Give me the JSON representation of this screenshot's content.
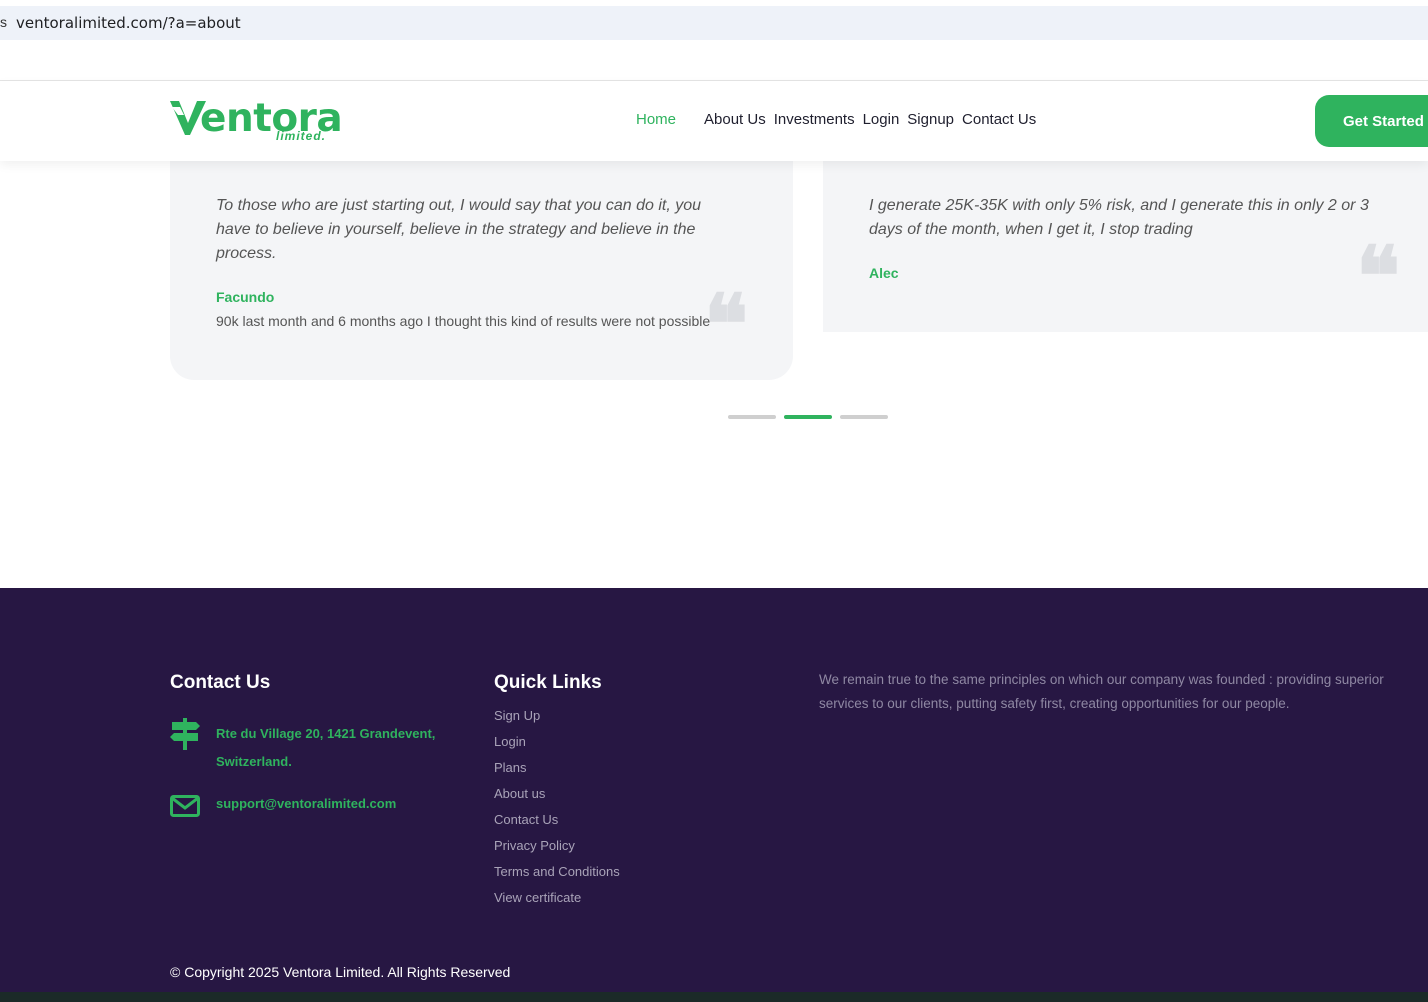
{
  "browser": {
    "lead_glyph": "s",
    "url": "ventoralimited.com/?a=about"
  },
  "header": {
    "logo_text": "entora",
    "logo_sub": "limited.",
    "nav": [
      {
        "label": "Home",
        "active": true
      },
      {
        "label": "About Us"
      },
      {
        "label": "Investments"
      },
      {
        "label": "Login"
      },
      {
        "label": "Signup"
      },
      {
        "label": "Contact Us"
      }
    ],
    "cta_label": "Get Started"
  },
  "testimonials": [
    {
      "quote": "To those who are just starting out, I would say that you can do it, you have to believe in yourself, believe in the strategy and believe in the process.",
      "author": "Facundo",
      "note": "90k last month and 6 months ago I thought this kind of results were not possible"
    },
    {
      "quote": "I generate 25K-35K with only 5% risk, and I generate this in only 2 or 3 days of the month, when I get it, I stop trading",
      "author": "Alec",
      "note": ""
    }
  ],
  "carousel": {
    "count": 3,
    "active_index": 1
  },
  "footer": {
    "contact_title": "Contact Us",
    "address": "Rte du Village 20, 1421 Grandevent, Switzerland.",
    "email": "support@ventoralimited.com",
    "links_title": "Quick Links",
    "links": [
      "Sign Up",
      "Login",
      "Plans",
      "About us",
      "Contact Us",
      "Privacy Policy",
      "Terms and Conditions",
      "View certificate"
    ],
    "about": "We remain true to the same principles on which our company was founded : providing superior services to our clients, putting safety first, creating opportunities for our people.",
    "copyright": "© Copyright 2025 Ventora Limited. All Rights Reserved"
  },
  "colors": {
    "brand_green": "#2fb35e",
    "footer_bg": "#271743",
    "card_bg": "#f4f5f7"
  },
  "icons": [
    "signpost-icon",
    "envelope-icon",
    "quote-icon",
    "logo-v-mark-icon"
  ]
}
